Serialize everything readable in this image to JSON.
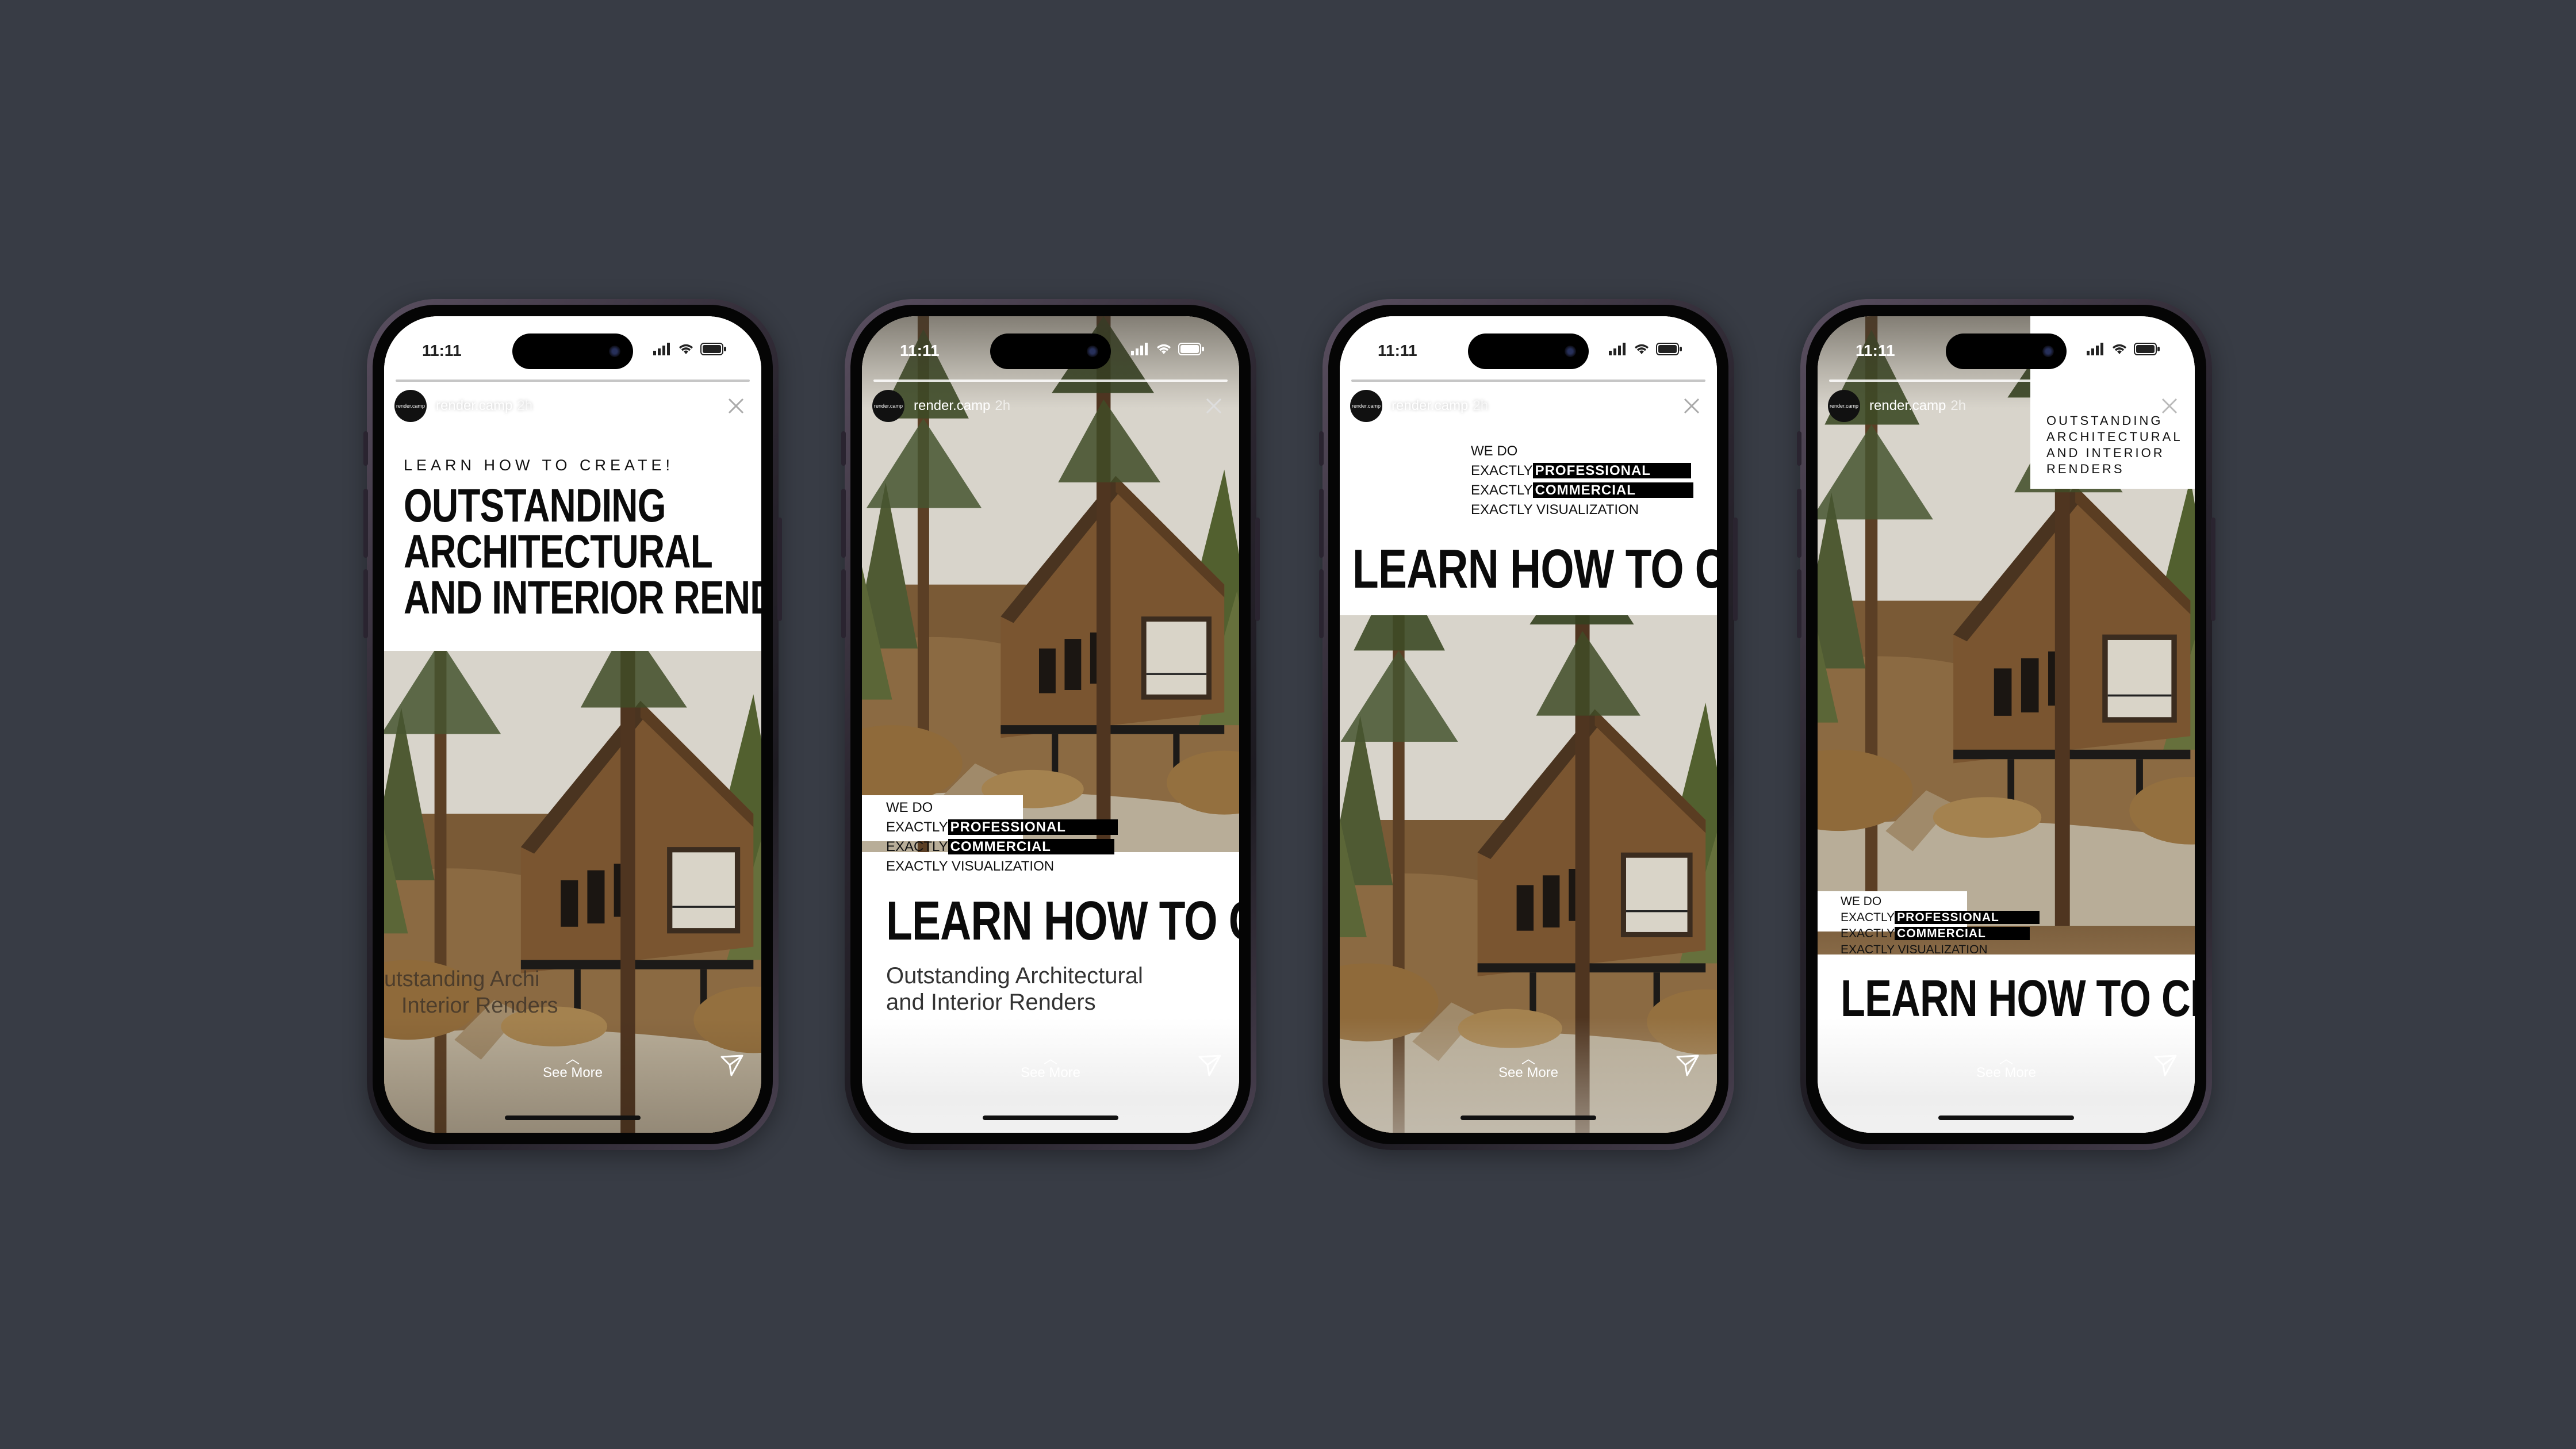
{
  "colors": {
    "background": "#383c45",
    "text": "#0b0b0b",
    "panel": "#ffffff",
    "highlight": "#000000"
  },
  "status": {
    "time": "11:11"
  },
  "story": {
    "account": "render.camp",
    "age": "2h",
    "avatar_text": "render.camp",
    "see_more": "See More"
  },
  "phone1": {
    "eyebrow": "LEARN HOW TO CREATE!",
    "headline": [
      "OUTSTANDING",
      "ARCHITECTURAL",
      "AND INTERIOR RENDERS"
    ],
    "overlay_text": [
      "utstanding Archi",
      "Interior Renders"
    ]
  },
  "phone2": {
    "we_do": "WE DO",
    "lines": [
      {
        "prefix": "EXACTLY",
        "highlight": "PROFESSIONAL"
      },
      {
        "prefix": "EXACTLY",
        "highlight": "COMMERCIAL"
      },
      {
        "prefix": "EXACTLY VISUALIZATION",
        "highlight": ""
      }
    ],
    "headline": "LEARN HOW TO CREATE",
    "subline": [
      "Outstanding Architectural",
      "and Interior Renders"
    ]
  },
  "phone3": {
    "we_do": "WE DO",
    "lines": [
      {
        "prefix": "EXACTLY",
        "highlight": "PROFESSIONAL"
      },
      {
        "prefix": "EXACTLY",
        "highlight": "COMMERCIAL"
      },
      {
        "prefix": "EXACTLY VISUALIZATION",
        "highlight": ""
      }
    ],
    "headline": "LEARN HOW TO CREATE"
  },
  "phone4": {
    "corner_text": [
      "OUTSTANDING",
      "ARCHITECTURAL",
      "AND INTERIOR",
      "RENDERS"
    ],
    "we_do": "WE DO",
    "lines": [
      {
        "prefix": "EXACTLY",
        "highlight": "PROFESSIONAL"
      },
      {
        "prefix": "EXACTLY",
        "highlight": "COMMERCIAL"
      },
      {
        "prefix": "EXACTLY VISUALIZATION",
        "highlight": ""
      }
    ],
    "headline": "LEARN HOW TO CREATE"
  },
  "icons": [
    "signal-icon",
    "wifi-icon",
    "battery-icon",
    "close-icon",
    "send-icon",
    "chevron-up-icon"
  ]
}
